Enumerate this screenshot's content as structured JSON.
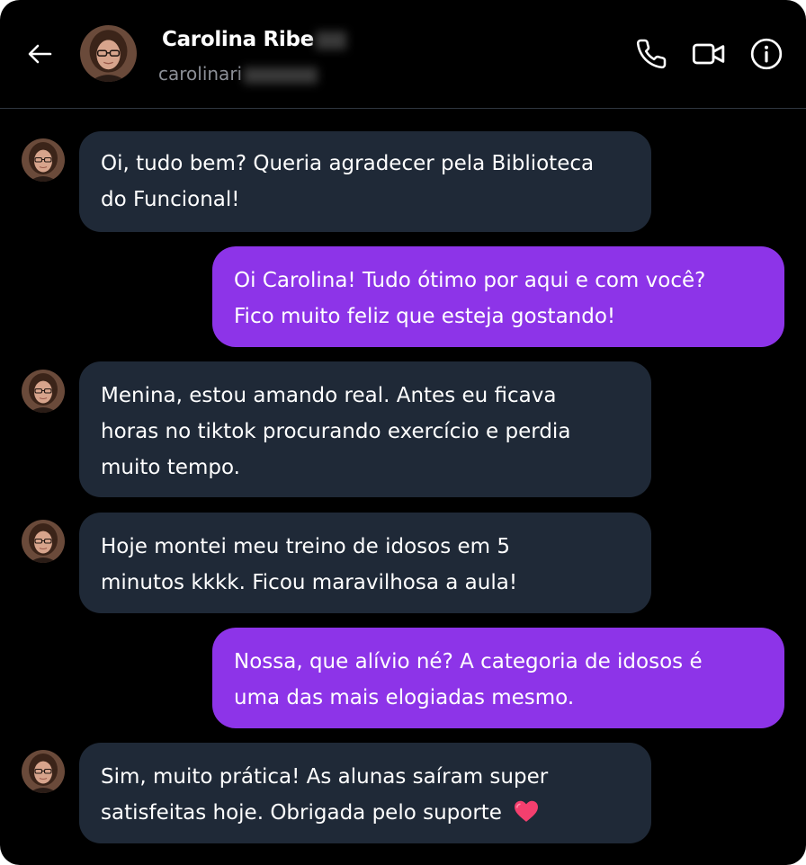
{
  "contact": {
    "name": "Carolina Ribe",
    "username": "carolinari"
  },
  "header": {
    "icons": [
      "back-arrow-icon",
      "phone-icon",
      "video-camera-icon",
      "info-icon"
    ]
  },
  "messages": [
    {
      "side": "in",
      "lines": [
        "Oi, tudo bem? Queria agradecer pela Biblioteca",
        "do Funcional!"
      ]
    },
    {
      "side": "out",
      "lines": [
        "Oi Carolina! Tudo ótimo por aqui e com você?",
        "Fico muito feliz que esteja gostando!"
      ]
    },
    {
      "side": "in",
      "lines": [
        "Menina, estou amando real. Antes eu ficava",
        "horas no tiktok procurando exercício e perdia",
        "muito tempo."
      ]
    },
    {
      "side": "in",
      "lines": [
        "Hoje montei meu treino de idosos em 5",
        "minutos kkkk. Ficou maravilhosa a aula!"
      ]
    },
    {
      "side": "out",
      "lines": [
        "Nossa, que alívio né? A categoria de idosos é",
        "uma das mais elogiadas mesmo."
      ]
    },
    {
      "side": "in",
      "lines": [
        "Sim, muito prática! As alunas saíram super",
        "satisfeitas hoje. Obrigada pelo suporte"
      ],
      "emoji": "heart-emoji"
    }
  ],
  "colors": {
    "background": "#000000",
    "incoming_bubble": "#1f2937",
    "outgoing_bubble": "#8d34e8",
    "username": "#8b8f96",
    "heart": "#f43f6e"
  }
}
